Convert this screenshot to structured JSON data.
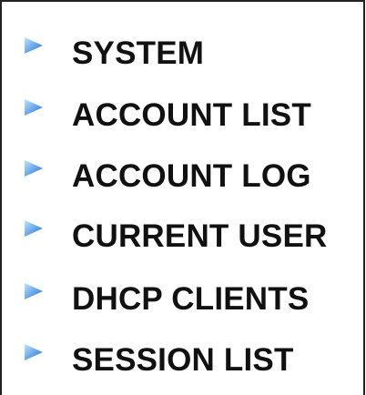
{
  "menu": {
    "items": [
      {
        "label": "SYSTEM",
        "icon": "triangle-right-icon"
      },
      {
        "label": "ACCOUNT LIST",
        "icon": "triangle-right-icon"
      },
      {
        "label": "ACCOUNT LOG",
        "icon": "triangle-right-icon"
      },
      {
        "label": "CURRENT USER",
        "icon": "triangle-right-icon"
      },
      {
        "label": "DHCP CLIENTS",
        "icon": "triangle-right-icon"
      },
      {
        "label": "SESSION LIST",
        "icon": "triangle-right-icon"
      }
    ]
  },
  "colors": {
    "icon_light": "#9fd0ff",
    "icon_dark": "#1e6fd6",
    "text": "#111111",
    "border": "#222222"
  }
}
